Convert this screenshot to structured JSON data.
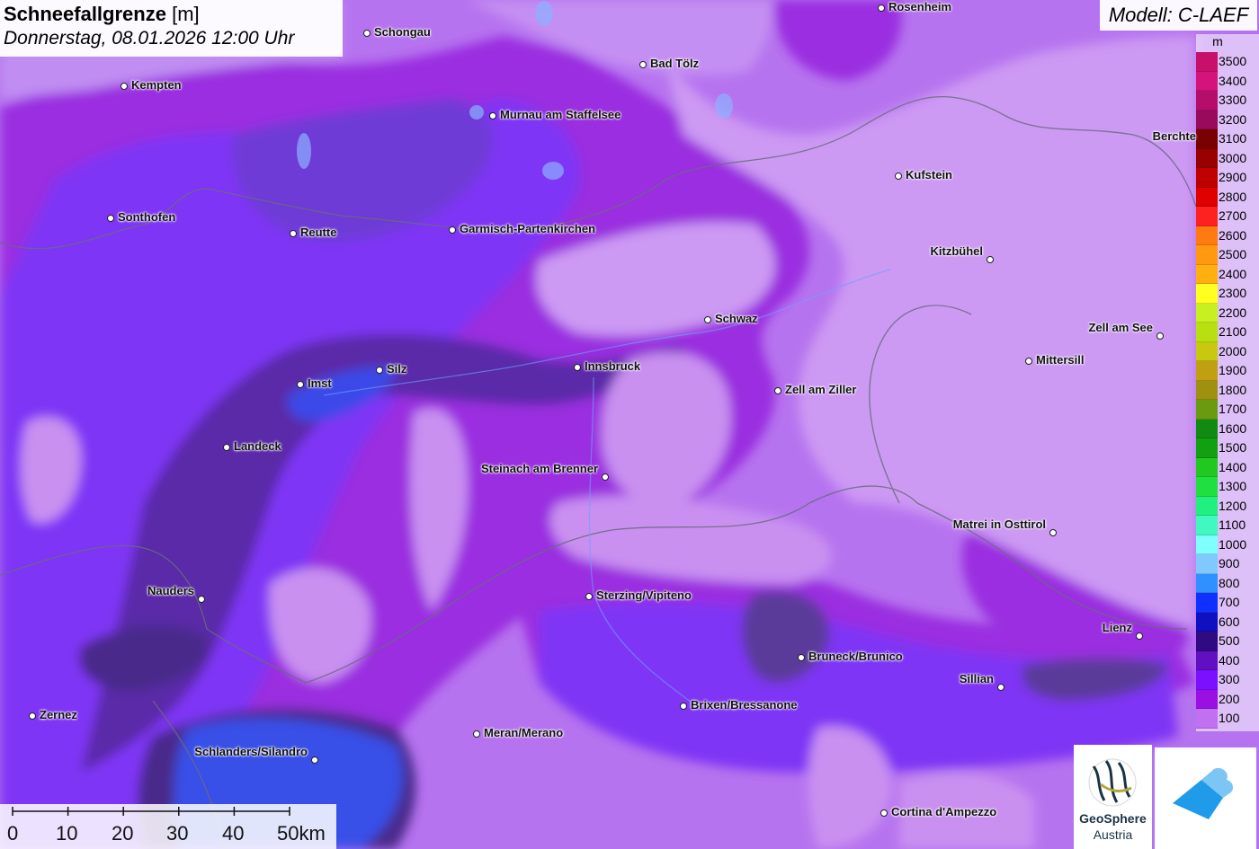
{
  "title": {
    "param": "Schneefallgrenze",
    "unit": "[m]",
    "datetime": "Donnerstag, 08.01.2026 12:00 Uhr"
  },
  "model": "Modell: C-LAEF",
  "legend": {
    "unit": "m",
    "items": [
      {
        "label": "3500",
        "color": "#c8106a"
      },
      {
        "label": "3400",
        "color": "#d4147a"
      },
      {
        "label": "3300",
        "color": "#b50d6a"
      },
      {
        "label": "3200",
        "color": "#9a0a5c"
      },
      {
        "label": "3100",
        "color": "#7a0000"
      },
      {
        "label": "3000",
        "color": "#9b0000"
      },
      {
        "label": "2900",
        "color": "#c00000"
      },
      {
        "label": "2800",
        "color": "#e00000"
      },
      {
        "label": "2700",
        "color": "#ff2020"
      },
      {
        "label": "2600",
        "color": "#ff7a10"
      },
      {
        "label": "2500",
        "color": "#ff9a10"
      },
      {
        "label": "2400",
        "color": "#ffb010"
      },
      {
        "label": "2300",
        "color": "#ffff20"
      },
      {
        "label": "2200",
        "color": "#c8f020"
      },
      {
        "label": "2100",
        "color": "#b8e010"
      },
      {
        "label": "2000",
        "color": "#c8c810"
      },
      {
        "label": "1900",
        "color": "#c0a010"
      },
      {
        "label": "1800",
        "color": "#a09010"
      },
      {
        "label": "1700",
        "color": "#6a9a10"
      },
      {
        "label": "1600",
        "color": "#108a10"
      },
      {
        "label": "1500",
        "color": "#10a010"
      },
      {
        "label": "1400",
        "color": "#20c820"
      },
      {
        "label": "1300",
        "color": "#20e040"
      },
      {
        "label": "1200",
        "color": "#20f080"
      },
      {
        "label": "1100",
        "color": "#40f8c0"
      },
      {
        "label": "1000",
        "color": "#80ffff"
      },
      {
        "label": "900",
        "color": "#80c8ff"
      },
      {
        "label": "800",
        "color": "#3090ff"
      },
      {
        "label": "700",
        "color": "#1030ff"
      },
      {
        "label": "600",
        "color": "#1010c0"
      },
      {
        "label": "500",
        "color": "#300a80"
      },
      {
        "label": "400",
        "color": "#6010c0"
      },
      {
        "label": "300",
        "color": "#7a10ff"
      },
      {
        "label": "200",
        "color": "#9a10e0"
      },
      {
        "label": "100",
        "color": "#c070f0"
      }
    ]
  },
  "cities": [
    {
      "name": "Rosenheim"
    },
    {
      "name": "Schongau"
    },
    {
      "name": "Kempten"
    },
    {
      "name": "Bad Tölz"
    },
    {
      "name": "Murnau am Staffelsee"
    },
    {
      "name": "Berchte"
    },
    {
      "name": "Kufstein"
    },
    {
      "name": "Sonthofen"
    },
    {
      "name": "Reutte"
    },
    {
      "name": "Garmisch-Partenkirchen"
    },
    {
      "name": "Kitzbühel"
    },
    {
      "name": "Schwaz"
    },
    {
      "name": "Zell am See"
    },
    {
      "name": "Mittersill"
    },
    {
      "name": "Imst"
    },
    {
      "name": "Silz"
    },
    {
      "name": "Innsbruck"
    },
    {
      "name": "Zell am Ziller"
    },
    {
      "name": "Landeck"
    },
    {
      "name": "Steinach am Brenner"
    },
    {
      "name": "Matrei in Osttirol"
    },
    {
      "name": "Nauders"
    },
    {
      "name": "Sterzing/Vipiteno"
    },
    {
      "name": "Lienz"
    },
    {
      "name": "Bruneck/Brunico"
    },
    {
      "name": "Sillian"
    },
    {
      "name": "Brixen/Bressanone"
    },
    {
      "name": "Zernez"
    },
    {
      "name": "Meran/Merano"
    },
    {
      "name": "Schlanders/Silandro"
    },
    {
      "name": "Cortina d'Ampezzo"
    }
  ],
  "scalebar": {
    "labels": [
      "0",
      "10",
      "20",
      "30",
      "40",
      "50km"
    ]
  },
  "logos": {
    "geosphere_line1": "GeoSphere",
    "geosphere_line2": "Austria",
    "geosphere_icon": "geosphere-logo-icon",
    "cloud_icon": "cloud-logo-icon"
  }
}
